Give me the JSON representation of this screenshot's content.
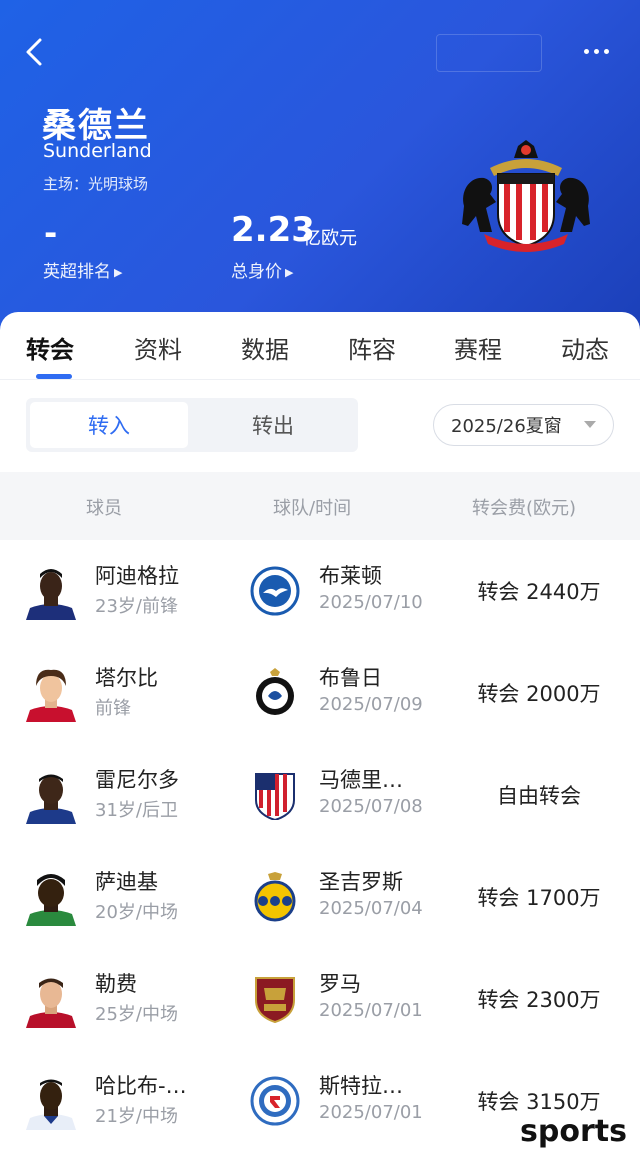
{
  "header": {
    "team_name": "桑德兰",
    "team_name_en": "Sunderland",
    "home_ground": "主场：光明球场",
    "rank_value": "-",
    "rank_label": "英超排名",
    "value_number": "2.23",
    "value_unit": "亿欧元",
    "value_label": "总身价",
    "crest_name": "SUNDERLAND A.F.C."
  },
  "tabs": [
    "转会",
    "资料",
    "数据",
    "阵容",
    "赛程",
    "动态"
  ],
  "segment": {
    "in_label": "转入",
    "out_label": "转出"
  },
  "window_select": {
    "value": "2025/26夏窗"
  },
  "table": {
    "col_player": "球员",
    "col_team_time": "球队/时间",
    "col_fee": "转会费(欧元)"
  },
  "rows": [
    {
      "player": "阿迪格拉",
      "info": "23岁/前锋",
      "club": "布莱顿",
      "date": "2025/07/10",
      "fee": "转会 2440万"
    },
    {
      "player": "塔尔比",
      "info": "前锋",
      "club": "布鲁日",
      "date": "2025/07/09",
      "fee": "转会 2000万"
    },
    {
      "player": "雷尼尔多",
      "info": "31岁/后卫",
      "club": "马德里…",
      "date": "2025/07/08",
      "fee": "自由转会"
    },
    {
      "player": "萨迪基",
      "info": "20岁/中场",
      "club": "圣吉罗斯",
      "date": "2025/07/04",
      "fee": "转会 1700万"
    },
    {
      "player": "勒费",
      "info": "25岁/中场",
      "club": "罗马",
      "date": "2025/07/01",
      "fee": "转会 2300万"
    },
    {
      "player": "哈比布-…",
      "info": "21岁/中场",
      "club": "斯特拉…",
      "date": "2025/07/01",
      "fee": "转会 3150万"
    }
  ],
  "watermark": "sports",
  "colors": {
    "header_blue": "#2a56dc",
    "accent": "#2f6cf2"
  }
}
